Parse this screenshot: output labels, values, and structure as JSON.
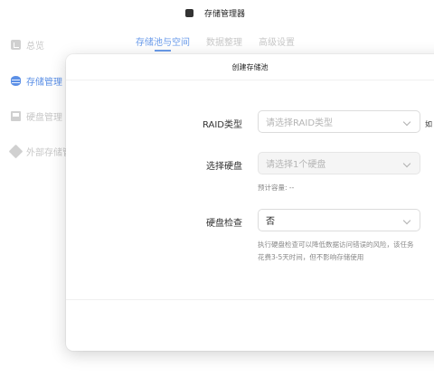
{
  "window": {
    "title": "存储管理器"
  },
  "sidebar": {
    "items": [
      {
        "label": "总览",
        "icon": "overview-icon",
        "active": false
      },
      {
        "label": "存储管理",
        "icon": "storage-icon",
        "active": true
      },
      {
        "label": "硬盘管理",
        "icon": "disk-icon",
        "active": false
      },
      {
        "label": "外部存储管",
        "icon": "external-storage-icon",
        "active": false
      }
    ]
  },
  "tabs": [
    {
      "label": "存储池与空间",
      "active": true
    },
    {
      "label": "数据整理",
      "active": false
    },
    {
      "label": "高级设置",
      "active": false
    }
  ],
  "modal": {
    "title": "创建存储池",
    "raid": {
      "label": "RAID类型",
      "placeholder": "请选择RAID类型",
      "side_note": "如"
    },
    "disk": {
      "label": "选择硬盘",
      "placeholder": "请选择1个硬盘",
      "capacity_hint": "预计容量: --"
    },
    "check": {
      "label": "硬盘检查",
      "value": "否",
      "hint_line1": "执行硬盘检查可以降低数据访问错误的风险，该任务",
      "hint_line2": "花费3-5天时间，但不影响存储使用"
    }
  },
  "colors": {
    "accent": "#5b8fe6",
    "muted": "#c8c8c8"
  }
}
